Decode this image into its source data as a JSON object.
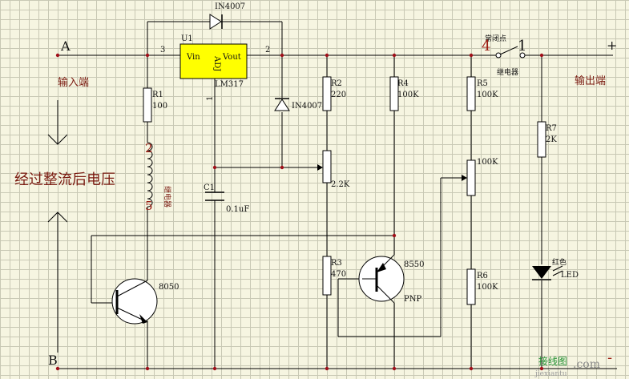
{
  "labels": {
    "node_a": "A",
    "node_b": "B",
    "input_terminal": "输入端",
    "output_terminal": "输出端",
    "plus": "+",
    "minus": "-",
    "rectified_voltage": "经过整流后电压",
    "diode_top": "IN4007",
    "u1": "U1",
    "pin3": "3",
    "pin2": "2",
    "pin1": "1",
    "vin": "Vin",
    "vout": "Vout",
    "adj": "ADJ",
    "lm317": "LM317",
    "diode_vertical": "IN4007",
    "r1": "R1",
    "r1_value": "100",
    "coil_pin2": "2",
    "coil_pin5": "5",
    "relay_coil": "继电器",
    "c1": "C1",
    "c1_value": "0.1uF",
    "r2": "R2",
    "r2_value": "220",
    "pot1_value": "2.2K",
    "r3": "R3",
    "r3_value": "470",
    "r4": "R4",
    "r4_value": "100K",
    "pnp_part": "8550",
    "pnp_type": "PNP",
    "npn_part": "8050",
    "r5": "R5",
    "r5_value": "100K",
    "pot2_value": "100K",
    "r6": "R6",
    "r6_value": "100K",
    "r7": "R7",
    "r7_value": "2K",
    "led_color": "红色",
    "led": "LED",
    "normally_closed": "常闭点",
    "contact_pin4": "4",
    "contact_pin1": "1",
    "relay_contact": "继电器",
    "watermark_cn": "接线图",
    "watermark_domain": ".com",
    "watermark_sub": "jiexiantu"
  },
  "colors": {
    "background": "#f6f5e1",
    "grid": "#c8c8b4",
    "regulator_fill": "#ffff00",
    "label_dark_red": "#7a1a10",
    "junction": "#a0101a"
  }
}
